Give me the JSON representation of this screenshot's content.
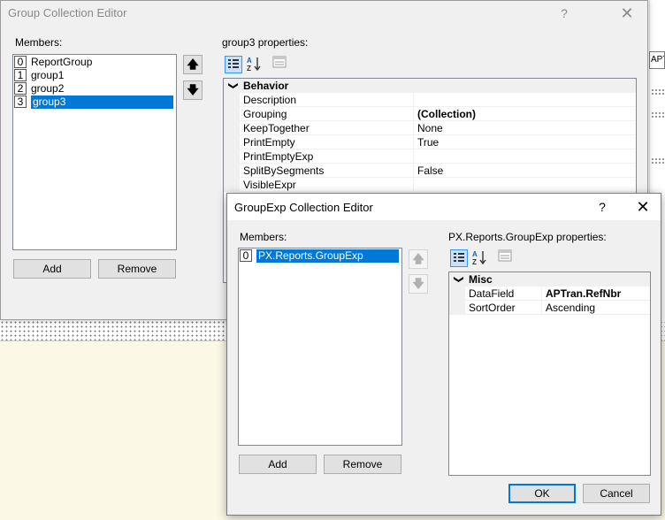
{
  "background": {
    "stub_text": "APTr"
  },
  "dialog1": {
    "title": "Group Collection Editor",
    "help_glyph": "?",
    "close_glyph": "✕",
    "members_label": "Members:",
    "members": [
      {
        "index": "0",
        "name": "ReportGroup"
      },
      {
        "index": "1",
        "name": "group1"
      },
      {
        "index": "2",
        "name": "group2"
      },
      {
        "index": "3",
        "name": "group3"
      }
    ],
    "selected_member": "group3",
    "move_up_glyph": "🡅",
    "move_down_glyph": "🡇",
    "add_label": "Add",
    "remove_label": "Remove",
    "properties_label": "group3 properties:",
    "properties": {
      "category": "Behavior",
      "rows": [
        {
          "name": "Description",
          "value": ""
        },
        {
          "name": "Grouping",
          "value": "(Collection)",
          "bold": true
        },
        {
          "name": "KeepTogether",
          "value": "None"
        },
        {
          "name": "PrintEmpty",
          "value": "True"
        },
        {
          "name": "PrintEmptyExp",
          "value": ""
        },
        {
          "name": "SplitBySegments",
          "value": "False"
        },
        {
          "name": "VisibleExpr",
          "value": ""
        }
      ]
    }
  },
  "dialog2": {
    "title": "GroupExp Collection Editor",
    "help_glyph": "?",
    "close_glyph": "✕",
    "members_label": "Members:",
    "members": [
      {
        "index": "0",
        "name": "PX.Reports.GroupExp"
      }
    ],
    "move_up_glyph": "🡅",
    "move_down_glyph": "🡇",
    "add_label": "Add",
    "remove_label": "Remove",
    "properties_label": "PX.Reports.GroupExp properties:",
    "properties": {
      "category": "Misc",
      "rows": [
        {
          "name": "DataField",
          "value": "APTran.RefNbr",
          "bold": true
        },
        {
          "name": "SortOrder",
          "value": "Ascending"
        }
      ]
    },
    "ok_label": "OK",
    "cancel_label": "Cancel"
  },
  "toolbar_icons": {
    "categorized": "categorized-icon",
    "alphabetical": "sort-alpha-icon",
    "property_pages": "property-pages-icon",
    "alpha_glyph_top": "A",
    "alpha_glyph_bottom": "Z"
  }
}
